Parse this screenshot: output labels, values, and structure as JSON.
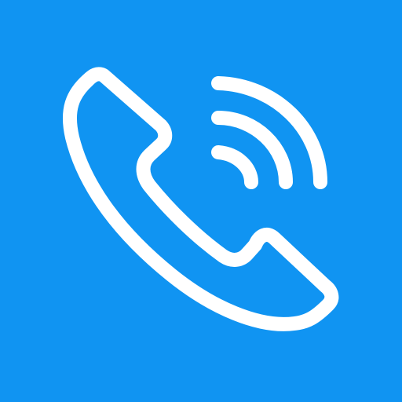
{
  "icon": {
    "name": "phone-call-icon",
    "background_color": "#1094f2",
    "stroke_color": "#ffffff"
  }
}
